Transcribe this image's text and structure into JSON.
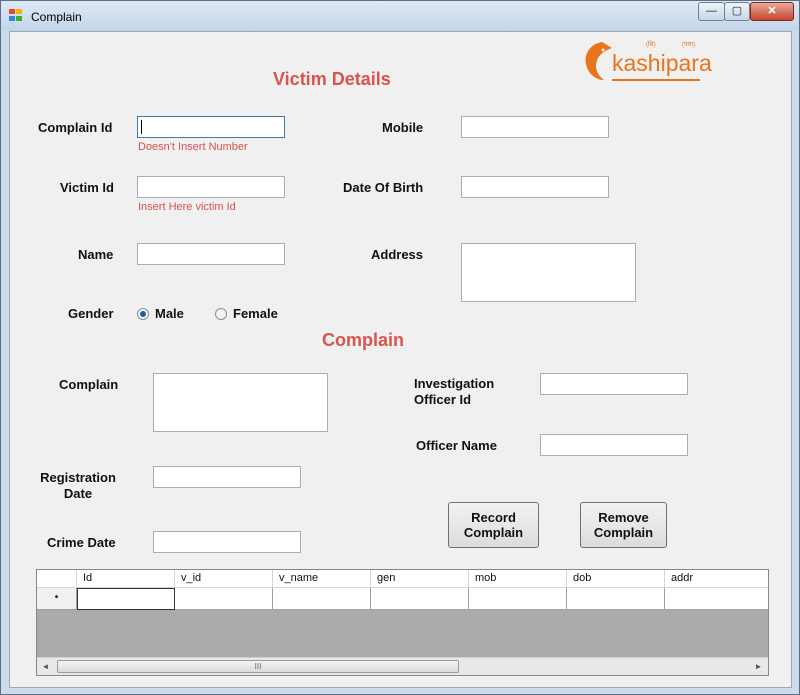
{
  "window": {
    "title": "Complain",
    "controls": {
      "minimize": "—",
      "maximize": "▢",
      "close": "✕"
    }
  },
  "logo": {
    "text_a": "kashi",
    "text_b": "para",
    "small_left": "(शि)",
    "small_right": "(पारा)"
  },
  "victim_section": {
    "heading": "Victim Details"
  },
  "fields": {
    "complain_id": {
      "label": "Complain Id",
      "value": "",
      "hint": "Doesn't  Insert  Number"
    },
    "victim_id": {
      "label": "Victim Id",
      "value": "",
      "hint": "Insert  Here  victim  Id"
    },
    "name": {
      "label": "Name",
      "value": ""
    },
    "gender": {
      "label": "Gender",
      "options": [
        "Male",
        "Female"
      ],
      "selected": "Male"
    },
    "mobile": {
      "label": "Mobile",
      "value": ""
    },
    "dob": {
      "label": "Date Of Birth",
      "value": ""
    },
    "address": {
      "label": "Address",
      "value": ""
    }
  },
  "complain_section": {
    "heading": "Complain"
  },
  "complain_fields": {
    "complain": {
      "label": "Complain",
      "value": ""
    },
    "registration_date": {
      "label": "Registration Date",
      "value": ""
    },
    "crime_date": {
      "label": "Crime Date",
      "value": ""
    },
    "investigation_officer_id": {
      "label": "Investigation Officer Id",
      "value": ""
    },
    "officer_name": {
      "label": "Officer Name",
      "value": ""
    }
  },
  "buttons": {
    "record": "Record Complain",
    "remove": "Remove Complain"
  },
  "grid": {
    "columns": [
      "Id",
      "v_id",
      "v_name",
      "gen",
      "mob",
      "dob",
      "addr"
    ],
    "new_row_marker": "•",
    "scroll_left": "◄",
    "scroll_right": "►",
    "thumb_grip": "III"
  },
  "colors": {
    "accent_red": "#d9534f",
    "logo_orange": "#e8741c"
  }
}
